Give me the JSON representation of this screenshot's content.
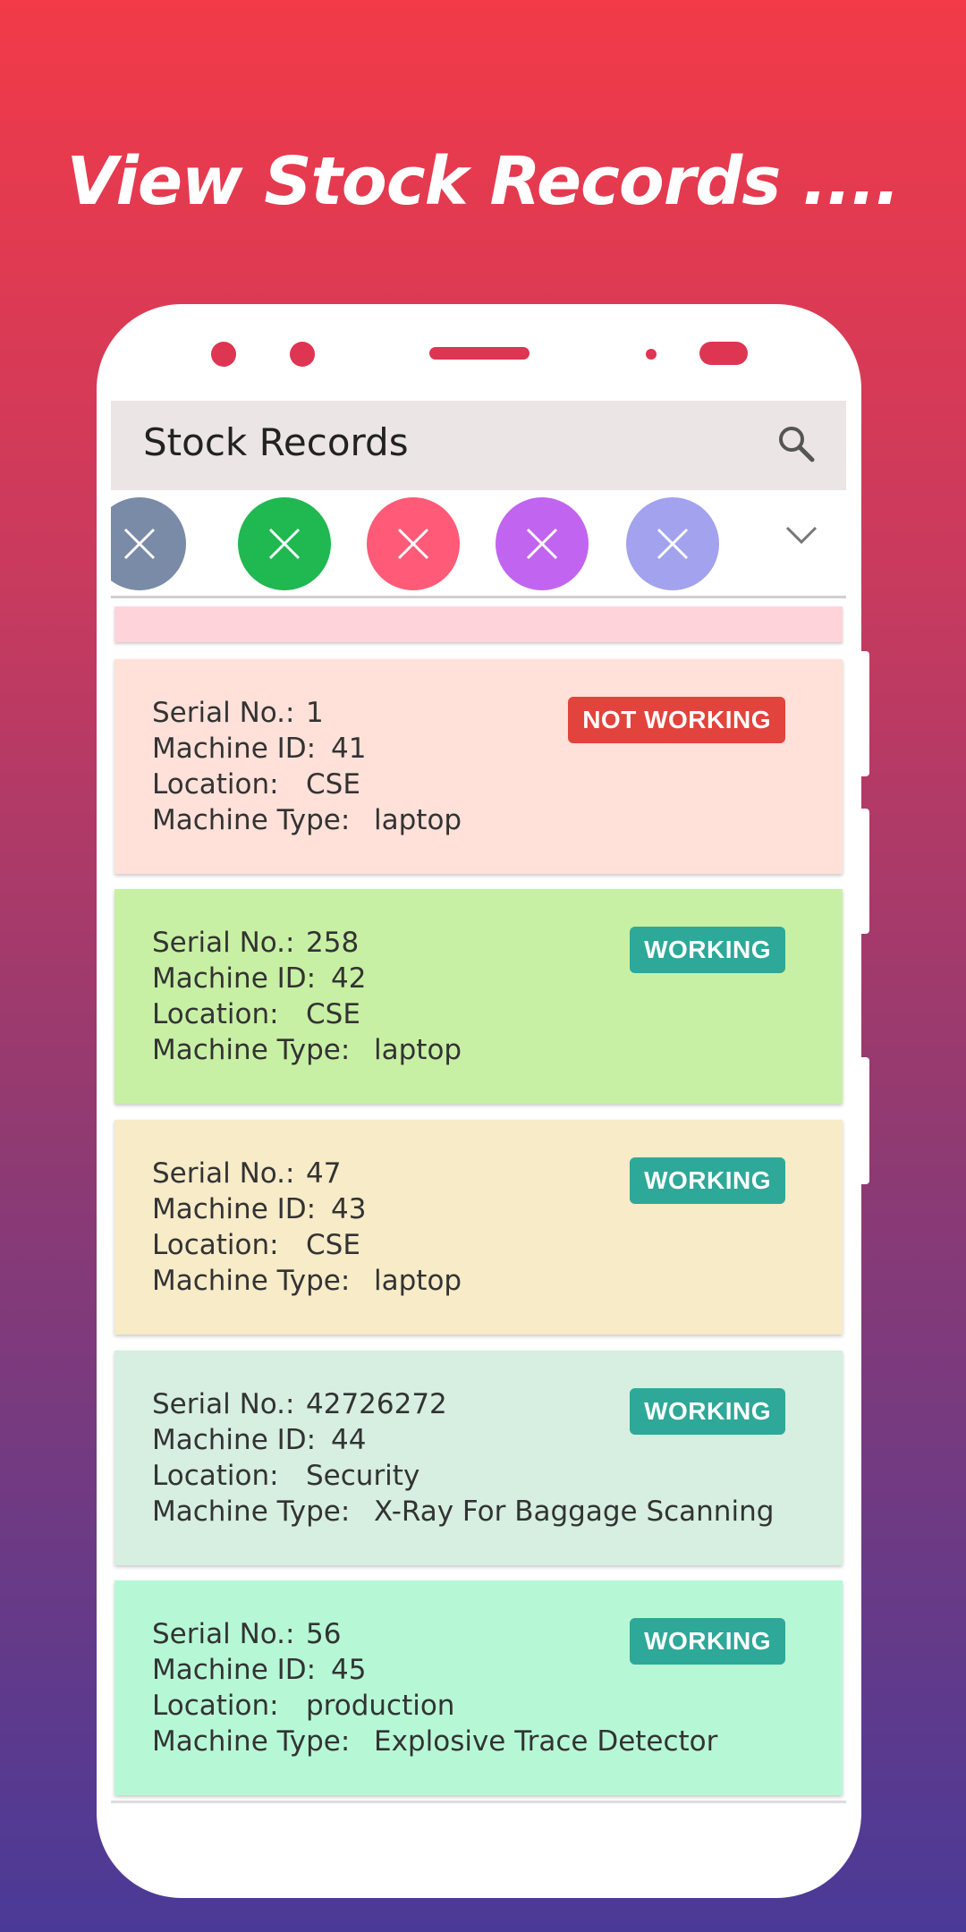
{
  "headline": "View Stock Records ....",
  "app": {
    "title": "Stock Records",
    "search_icon": "search-icon"
  },
  "filters": [
    {
      "color": "#7a8ba8",
      "icon": "close-icon"
    },
    {
      "color": "#1fb851",
      "icon": "close-icon"
    },
    {
      "color": "#ff5a77",
      "icon": "close-icon"
    },
    {
      "color": "#c165f0",
      "icon": "close-icon"
    },
    {
      "color": "#a2a2ee",
      "icon": "close-icon"
    }
  ],
  "labels": {
    "serial": "Serial No.:",
    "machine_id": "Machine ID:",
    "location": "Location:",
    "machine_type": "Machine Type:"
  },
  "records": [
    {
      "serial": "1",
      "machine_id": "41",
      "location": "CSE",
      "machine_type": "laptop",
      "status": "NOT WORKING",
      "status_color": "#e2433d",
      "bg": "#ffe1d9"
    },
    {
      "serial": "258",
      "machine_id": "42",
      "location": "CSE",
      "machine_type": "laptop",
      "status": "WORKING",
      "status_color": "#2ea898",
      "bg": "#c8f0a4"
    },
    {
      "serial": "47",
      "machine_id": "43",
      "location": "CSE",
      "machine_type": "laptop",
      "status": "WORKING",
      "status_color": "#2ea898",
      "bg": "#f7ebc8"
    },
    {
      "serial": "42726272",
      "machine_id": "44",
      "location": "Security",
      "machine_type": "X-Ray For Baggage Scanning",
      "status": "WORKING",
      "status_color": "#2ea898",
      "bg": "#d6efe0"
    },
    {
      "serial": "56",
      "machine_id": "45",
      "location": "production",
      "machine_type": "Explosive Trace Detector",
      "status": "WORKING",
      "status_color": "#2ea898",
      "bg": "#b6f8d6"
    }
  ]
}
